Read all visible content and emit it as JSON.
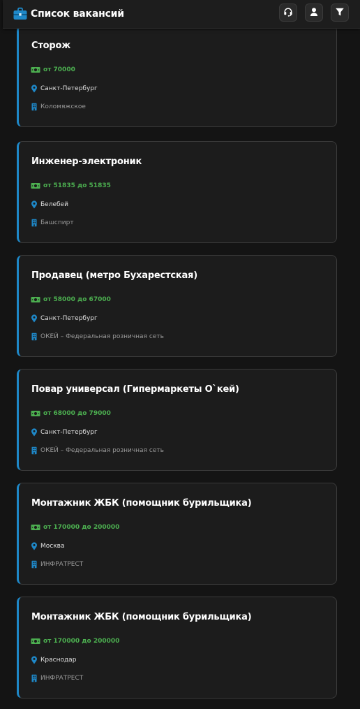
{
  "header": {
    "title": "Список вакансий",
    "icons": [
      "briefcase-icon",
      "headset-icon",
      "user-icon",
      "filter-icon"
    ]
  },
  "colors": {
    "background": "#141414",
    "card": "#1c1c1c",
    "accent": "#1e88c8",
    "salary": "#4caf50",
    "muted": "#9a9a9a"
  },
  "vacancies": [
    {
      "title": "Сторож",
      "salary": "от 70000",
      "city": "Санкт-Петербург",
      "company": "Коломяжское"
    },
    {
      "title": "Инженер-электроник",
      "salary": "от 51835 до 51835",
      "city": "Белебей",
      "company": "Башспирт"
    },
    {
      "title": "Продавец (метро Бухарестская)",
      "salary": "от 58000 до 67000",
      "city": "Санкт-Петербург",
      "company": "ОКЕЙ – Федеральная розничная сеть"
    },
    {
      "title": "Повар универсал (Гипермаркеты О`кей)",
      "salary": "от 68000 до 79000",
      "city": "Санкт-Петербург",
      "company": "ОКЕЙ – Федеральная розничная сеть"
    },
    {
      "title": "Монтажник ЖБК (помощник бурильщика)",
      "salary": "от 170000 до 200000",
      "city": "Москва",
      "company": "ИНФРАТРЕСТ"
    },
    {
      "title": "Монтажник ЖБК (помощник бурильщика)",
      "salary": "от 170000 до 200000",
      "city": "Краснодар",
      "company": "ИНФРАТРЕСТ"
    }
  ]
}
